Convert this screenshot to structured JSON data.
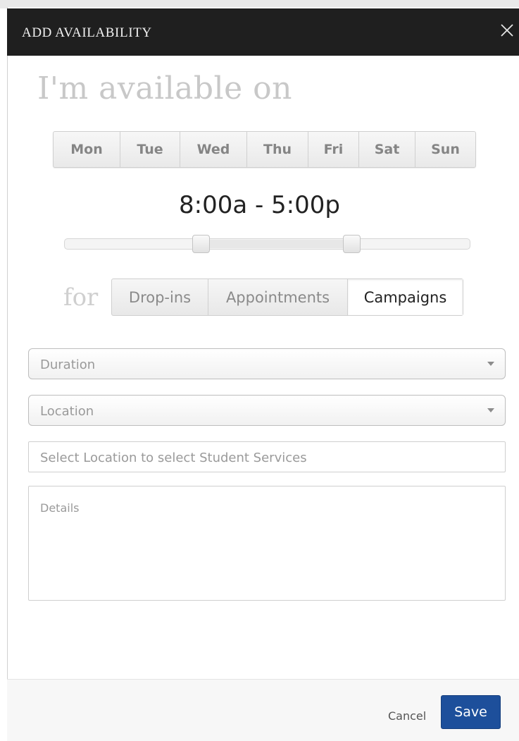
{
  "dialog": {
    "title": "ADD AVAILABILITY",
    "close_icon": "close-icon"
  },
  "heading": "I'm available on",
  "days": [
    "Mon",
    "Tue",
    "Wed",
    "Thu",
    "Fri",
    "Sat",
    "Sun"
  ],
  "time_range": "8:00a - 5:00p",
  "for_label": "for",
  "types": {
    "items": [
      "Drop-ins",
      "Appointments",
      "Campaigns"
    ],
    "selected": "Campaigns"
  },
  "duration": {
    "placeholder": "Duration"
  },
  "location": {
    "placeholder": "Location"
  },
  "student_services": {
    "placeholder": "Select Location to select Student Services"
  },
  "details": {
    "placeholder": "Details"
  },
  "footer": {
    "cancel_label": "Cancel",
    "save_label": "Save"
  },
  "colors": {
    "header_bg": "#1f1f1f",
    "save_bg": "#1d4f9b"
  }
}
